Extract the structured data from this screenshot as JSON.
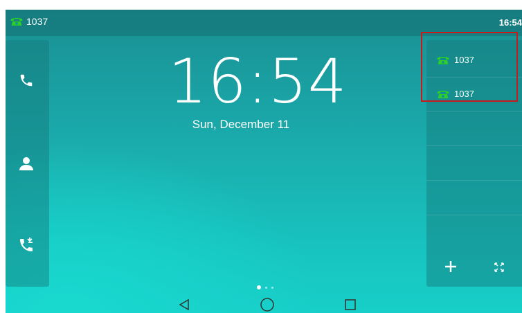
{
  "status_bar": {
    "account_label": "1037",
    "time": "16:54",
    "account_icon": "green-phone-icon"
  },
  "left_panel": {
    "items": [
      {
        "icon": "phone-icon"
      },
      {
        "icon": "contact-icon"
      },
      {
        "icon": "call-history-icon"
      }
    ]
  },
  "main": {
    "clock": "16:54",
    "date": "Sun, December 11"
  },
  "right_panel": {
    "accounts": [
      {
        "label": "1037",
        "icon": "green-phone-icon"
      },
      {
        "label": "1037",
        "icon": "green-phone-icon"
      }
    ],
    "add_icon": "plus-icon",
    "fullscreen_icon": "fullscreen-icon"
  },
  "navigation": {
    "back_icon": "back-triangle-icon",
    "home_icon": "home-circle-icon",
    "recent_icon": "recent-square-icon"
  },
  "colors": {
    "phone_green": "#2bd02b",
    "highlight": "#c81a1a"
  }
}
